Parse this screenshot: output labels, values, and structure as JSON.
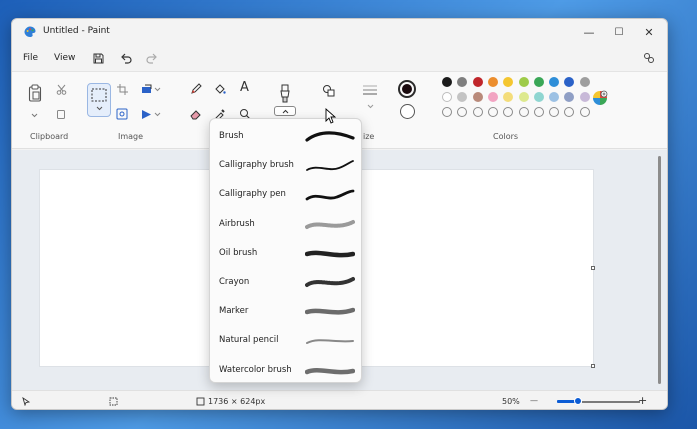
{
  "window": {
    "title": "Untitled - Paint",
    "controls": {
      "minimize": "—",
      "maximize": "☐",
      "close": "✕"
    }
  },
  "menu": {
    "file": "File",
    "view": "View"
  },
  "ribbon": {
    "groups": {
      "clipboard": "Clipboard",
      "image": "Image",
      "size": "ize",
      "colors": "Colors"
    },
    "tools": {
      "text": "A"
    }
  },
  "colors": {
    "accent": "#0b5cd5",
    "primary": "#1a0a0e",
    "row1": [
      "#1b1b1b",
      "#7f7f7f",
      "#c0262b",
      "#ec8e2e",
      "#f4c630",
      "#9ecb49",
      "#3aa757",
      "#2e8ed8",
      "#2b62c8",
      "#9e9e9e"
    ],
    "row2": [
      "#ffffff",
      "#c3c3c3",
      "#b98a7a",
      "#f2a4c2",
      "#f4dd7a",
      "#dde98e",
      "#8fd6d1",
      "#9cc1e4",
      "#8f9fc5",
      "#c8b9d8"
    ],
    "row3_empty": 10
  },
  "brush_menu": {
    "items": [
      {
        "label": "Brush",
        "style": "brush"
      },
      {
        "label": "Calligraphy brush",
        "style": "calligraphy-brush"
      },
      {
        "label": "Calligraphy pen",
        "style": "calligraphy-pen"
      },
      {
        "label": "Airbrush",
        "style": "airbrush"
      },
      {
        "label": "Oil brush",
        "style": "oil"
      },
      {
        "label": "Crayon",
        "style": "crayon"
      },
      {
        "label": "Marker",
        "style": "marker"
      },
      {
        "label": "Natural pencil",
        "style": "pencil"
      },
      {
        "label": "Watercolor brush",
        "style": "watercolor"
      }
    ]
  },
  "status": {
    "canvas_size": "1736 × 624px",
    "zoom": "50%",
    "zoom_level": 0.25,
    "minus": "—",
    "plus": "+"
  }
}
